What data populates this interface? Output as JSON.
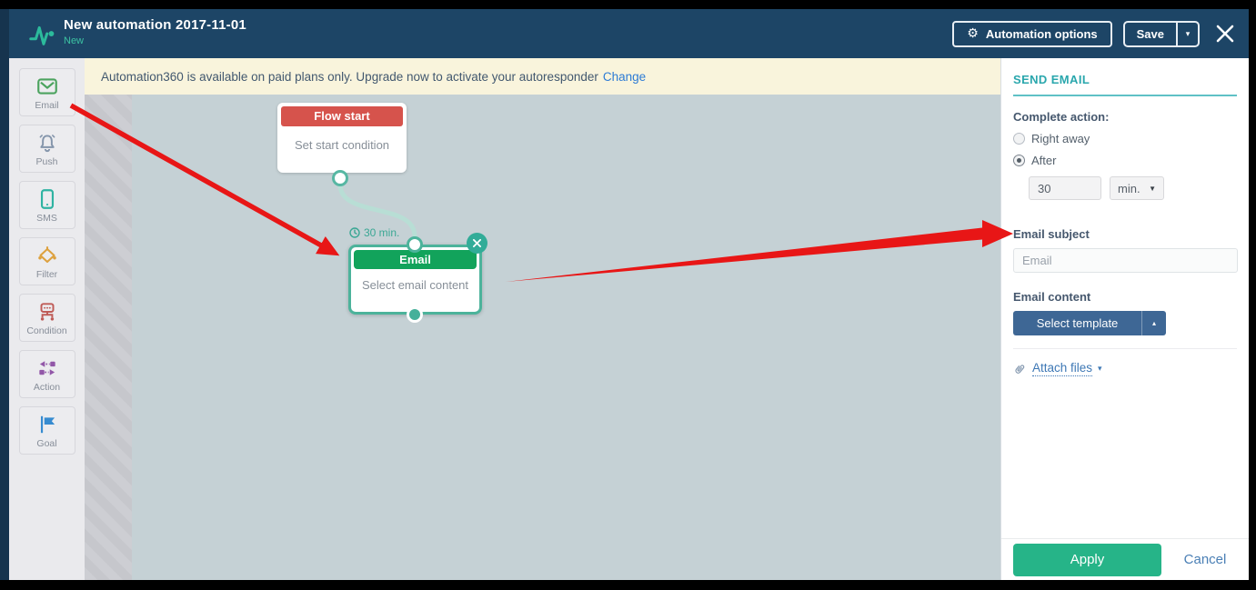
{
  "header": {
    "title": "New automation 2017-11-01",
    "subtitle": "New",
    "automation_options_label": "Automation options",
    "gear_glyph": "⚙",
    "save_label": "Save",
    "save_caret": "▾"
  },
  "notification": {
    "message": "Automation360 is available on paid plans only. Upgrade now to activate your autoresponder",
    "link_label": "Change"
  },
  "sidebar": {
    "items": [
      {
        "label": "Email",
        "icon": "envelope-icon",
        "color": "#4ca35f"
      },
      {
        "label": "Push",
        "icon": "bell-icon",
        "color": "#8495ab"
      },
      {
        "label": "SMS",
        "icon": "phone-icon",
        "color": "#2fb3a2"
      },
      {
        "label": "Filter",
        "icon": "filter-diamond-icon",
        "color": "#dda13f"
      },
      {
        "label": "Condition",
        "icon": "condition-icon",
        "color": "#bf5b57"
      },
      {
        "label": "Action",
        "icon": "action-icon",
        "color": "#9257a8"
      },
      {
        "label": "Goal",
        "icon": "goal-flag-icon",
        "color": "#368bd0"
      }
    ]
  },
  "canvas": {
    "flow_start_block": {
      "title": "Flow start",
      "body": "Set start condition"
    },
    "email_block": {
      "title": "Email",
      "body": "Select email content",
      "delay_badge": "30 min."
    }
  },
  "panel": {
    "title": "SEND EMAIL",
    "complete_action_label": "Complete action:",
    "radio_right_away_label": "Right away",
    "radio_right_away_selected": "false",
    "radio_after_label": "After",
    "radio_after_selected": "true",
    "delay_value": "30",
    "delay_unit": "min.",
    "unit_caret": "▼",
    "email_subject_label": "Email subject",
    "email_subject_value": "Email",
    "email_content_label": "Email content",
    "select_template_label": "Select template",
    "template_caret": "▴",
    "attach_files_label": "Attach files",
    "attach_caret": "▾",
    "apply_label": "Apply",
    "cancel_label": "Cancel"
  },
  "colors": {
    "header_bg": "#1d4566",
    "accent_teal": "#2cbb9c",
    "panel_title_teal": "#2aa7ad",
    "flow_start_red": "#d6534c",
    "email_green": "#12a35b",
    "block_border_teal": "#4cb39b",
    "apply_green": "#26b488",
    "select_template_blue": "#3e6795",
    "link_blue": "#2d7bd5",
    "annotation_red": "#e81616",
    "canvas_bg": "#c5d1d5",
    "notification_bg": "#f9f4dc"
  }
}
